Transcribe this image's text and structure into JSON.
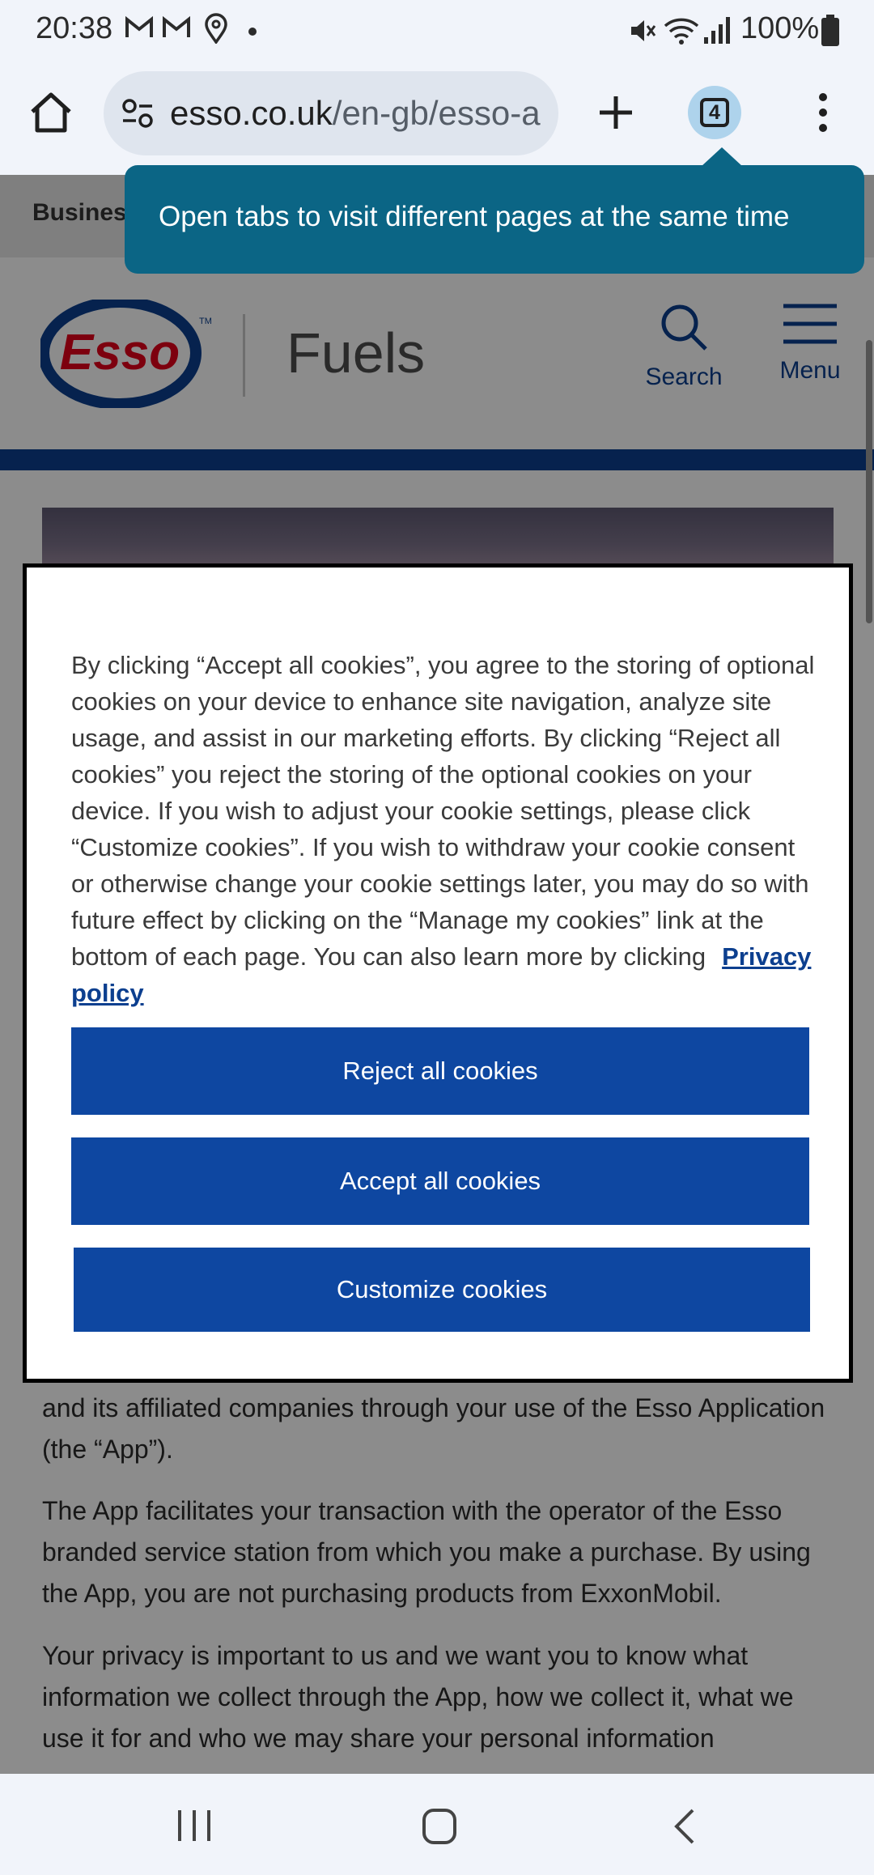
{
  "status_bar": {
    "time": "20:38",
    "notification_icons": [
      "gmail-icon",
      "gmail-icon",
      "location-icon",
      "dot-icon"
    ],
    "system_icons": [
      "mute-icon",
      "wifi-icon",
      "signal-icon",
      "battery-icon"
    ],
    "battery": "100%"
  },
  "browser": {
    "url_host": "esso.co.uk",
    "url_path": "/en-gb/esso-a",
    "tab_count": "4",
    "tooltip": "Open tabs to visit different pages at the same time"
  },
  "site": {
    "business_label": "Business",
    "brand_logo_text": "Esso",
    "section": "Fuels",
    "search_label": "Search",
    "menu_label": "Menu",
    "colors": {
      "brand_blue": "#0c3f8f",
      "esso_red": "#e3001b",
      "button_blue": "#0e47a1",
      "tooltip_bg": "#0b6585"
    }
  },
  "cookie_dialog": {
    "text": "By clicking “Accept all cookies”, you agree to the storing of optional cookies on your device to enhance site navigation, analyze site usage, and assist in our marketing efforts. By clicking “Reject all cookies” you reject the storing of the optional cookies on your device. If you wish to adjust your cookie settings, please click “Customize cookies”. If you wish to withdraw your cookie consent or otherwise change your cookie settings later, you may do so with future effect by clicking on the “Manage my cookies” link at the bottom of each page. You can also learn more by clicking",
    "privacy_link": "Privacy policy",
    "reject_label": "Reject all cookies",
    "accept_label": "Accept all cookies",
    "customize_label": "Customize cookies"
  },
  "page_content": {
    "paragraph_1": "and its affiliated companies through your use of the Esso Application (the “App”).",
    "paragraph_2": "The App facilitates your transaction with the operator of the Esso branded service station from which you make a purchase. By using the App, you are not purchasing products from ExxonMobil.",
    "paragraph_3": "Your privacy is important to us and we want you to know what information we collect through the App, how we collect it, what we use it for and who we may share your personal information"
  }
}
